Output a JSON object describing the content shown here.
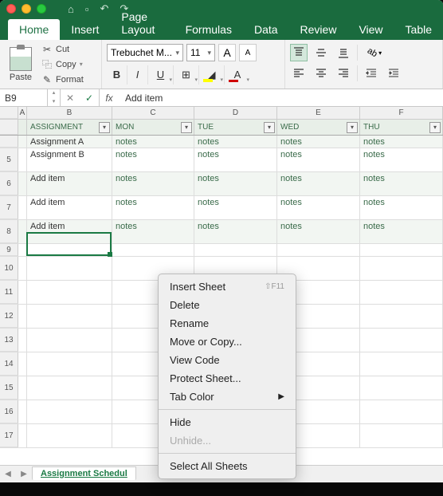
{
  "window": {
    "titlebar_icons": [
      "home",
      "save",
      "undo",
      "redo"
    ]
  },
  "ribbon": {
    "tabs": [
      "Home",
      "Insert",
      "Page Layout",
      "Formulas",
      "Data",
      "Review",
      "View",
      "Table"
    ],
    "active_tab": "Home",
    "paste_label": "Paste",
    "cut_label": "Cut",
    "copy_label": "Copy",
    "format_label": "Format",
    "font_name": "Trebuchet M...",
    "font_size": "11",
    "bold": "B",
    "italic": "I",
    "underline": "U",
    "font_big": "A",
    "font_small": "A",
    "bucket": "A",
    "fontcolor": "A"
  },
  "namebox": "B9",
  "fx_label": "fx",
  "formula_value": "Add item",
  "table": {
    "col_letters": [
      "A",
      "B",
      "C",
      "D",
      "E",
      "F"
    ],
    "headers": [
      "",
      "ASSIGNMENT",
      "MON",
      "TUE",
      "WED",
      "THU"
    ],
    "rows": [
      {
        "n": "",
        "cells": [
          "",
          "Assignment A",
          "notes",
          "notes",
          "notes",
          "notes"
        ]
      },
      {
        "n": "5",
        "cells": [
          "",
          "Assignment B",
          "notes",
          "notes",
          "notes",
          "notes"
        ]
      },
      {
        "n": "6",
        "cells": [
          "",
          "Add item",
          "notes",
          "notes",
          "notes",
          "notes"
        ]
      },
      {
        "n": "7",
        "cells": [
          "",
          "Add item",
          "notes",
          "notes",
          "notes",
          "notes"
        ]
      },
      {
        "n": "8",
        "cells": [
          "",
          "Add item",
          "notes",
          "notes",
          "notes",
          "notes"
        ]
      }
    ],
    "empty_rows": [
      "9",
      "10",
      "11",
      "12",
      "13",
      "14",
      "15",
      "16",
      "17"
    ]
  },
  "sheet_tab": "Assignment Schedul",
  "context_menu": {
    "items": [
      {
        "label": "Insert Sheet",
        "shortcut": "⇧F11"
      },
      {
        "label": "Delete"
      },
      {
        "label": "Rename"
      },
      {
        "label": "Move or Copy..."
      },
      {
        "label": "View Code"
      },
      {
        "label": "Protect Sheet..."
      },
      {
        "label": "Tab Color",
        "submenu": true
      }
    ],
    "items2": [
      {
        "label": "Hide"
      },
      {
        "label": "Unhide...",
        "disabled": true
      }
    ],
    "items3": [
      {
        "label": "Select All Sheets"
      }
    ]
  }
}
